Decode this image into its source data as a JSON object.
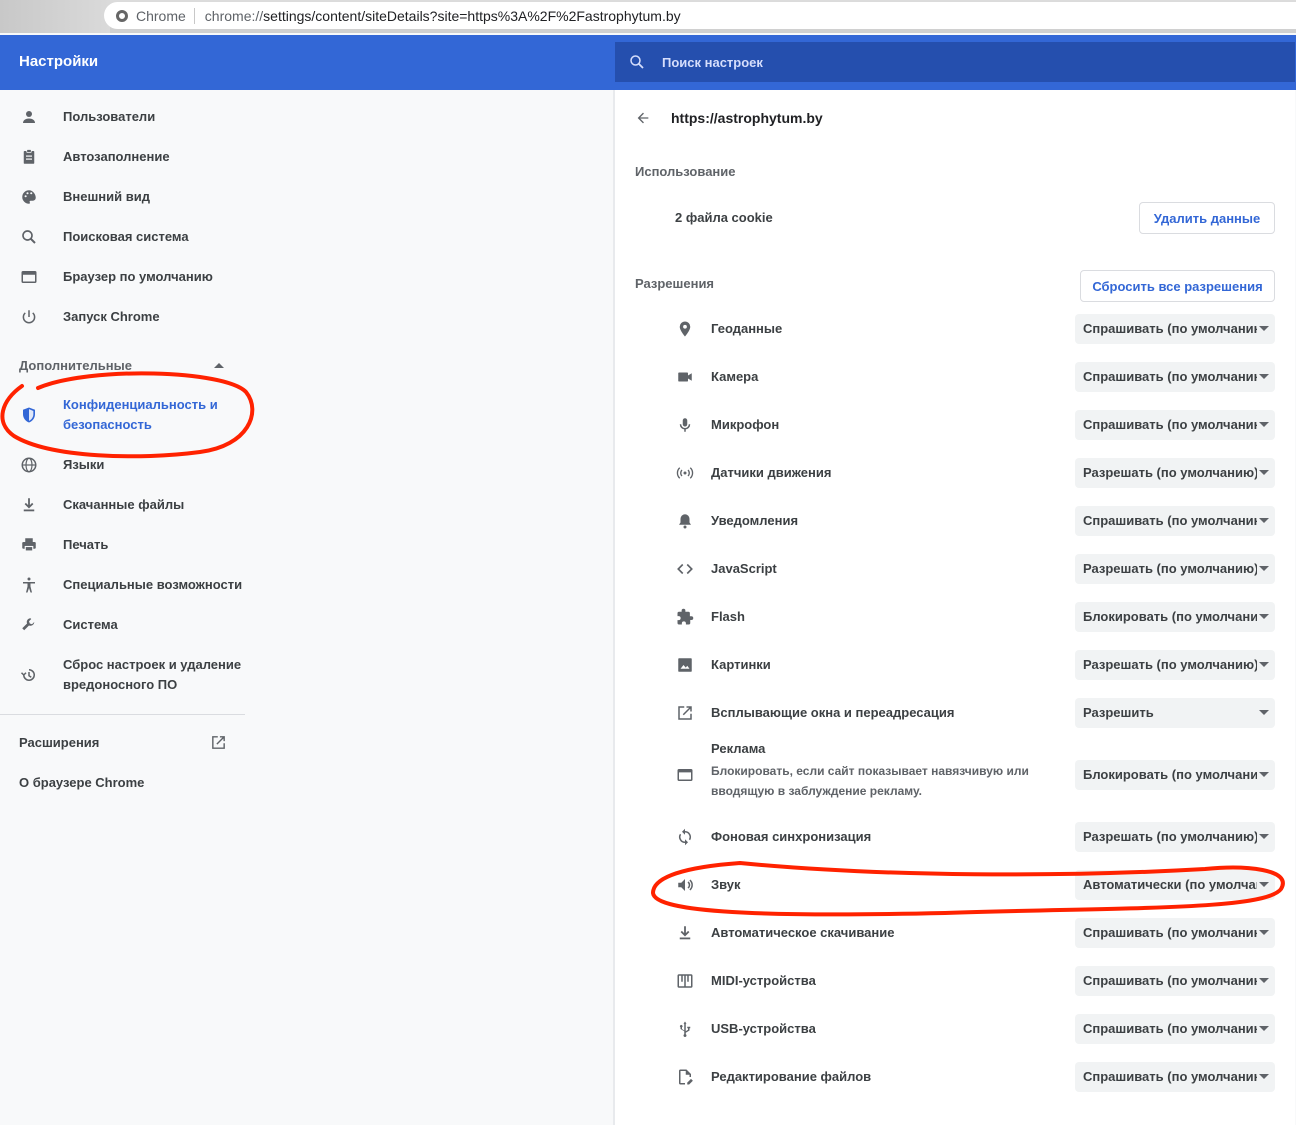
{
  "browser": {
    "site_label": "Chrome",
    "url_prefix": "chrome://",
    "url_rest": "settings/content/siteDetails?site=https%3A%2F%2Fastrophytum.by"
  },
  "header": {
    "title": "Настройки",
    "search_placeholder": "Поиск настроек"
  },
  "sidebar": {
    "items": [
      {
        "label": "Пользователи",
        "icon": "person-icon"
      },
      {
        "label": "Автозаполнение",
        "icon": "clipboard-icon"
      },
      {
        "label": "Внешний вид",
        "icon": "palette-icon"
      },
      {
        "label": "Поисковая система",
        "icon": "search-icon"
      },
      {
        "label": "Браузер по умолчанию",
        "icon": "browser-window-icon"
      },
      {
        "label": "Запуск Chrome",
        "icon": "power-icon"
      }
    ],
    "advanced_label": "Дополнительные",
    "advanced_items": [
      {
        "label": "Конфиденциальность и безопасность",
        "icon": "shield-icon"
      },
      {
        "label": "Языки",
        "icon": "globe-icon"
      },
      {
        "label": "Скачанные файлы",
        "icon": "download-icon"
      },
      {
        "label": "Печать",
        "icon": "printer-icon"
      },
      {
        "label": "Специальные возможности",
        "icon": "accessibility-icon"
      },
      {
        "label": "Система",
        "icon": "wrench-icon"
      },
      {
        "label": "Сброс настроек и удаление вредоносного ПО",
        "icon": "restore-icon"
      }
    ],
    "extensions_label": "Расширения",
    "about_label": "О браузере Chrome"
  },
  "main": {
    "site": "https://astrophytum.by",
    "usage_label": "Использование",
    "cookies": "2 файла cookie",
    "delete_button": "Удалить данные",
    "permissions_label": "Разрешения",
    "reset_button": "Сбросить все разрешения",
    "permissions": [
      {
        "name": "Геоданные",
        "value": "Спрашивать (по умолчанию)",
        "icon": "location-icon"
      },
      {
        "name": "Камера",
        "value": "Спрашивать (по умолчанию)",
        "icon": "camera-icon"
      },
      {
        "name": "Микрофон",
        "value": "Спрашивать (по умолчанию)",
        "icon": "microphone-icon"
      },
      {
        "name": "Датчики движения",
        "value": "Разрешать (по умолчанию)",
        "icon": "sensors-icon"
      },
      {
        "name": "Уведомления",
        "value": "Спрашивать (по умолчанию)",
        "icon": "bell-icon"
      },
      {
        "name": "JavaScript",
        "value": "Разрешать (по умолчанию)",
        "icon": "code-icon"
      },
      {
        "name": "Flash",
        "value": "Блокировать (по умолчанию)",
        "icon": "puzzle-icon"
      },
      {
        "name": "Картинки",
        "value": "Разрешать (по умолчанию)",
        "icon": "image-icon"
      },
      {
        "name": "Всплывающие окна и переадресация",
        "value": "Разрешить",
        "icon": "open-external-icon"
      },
      {
        "name": "Реклама",
        "desc": "Блокировать, если сайт показывает навязчивую или вводящую в заблуждение рекламу.",
        "value": "Блокировать (по умолчанию)",
        "icon": "ads-window-icon"
      },
      {
        "name": "Фоновая синхронизация",
        "value": "Разрешать (по умолчанию)",
        "icon": "sync-icon"
      },
      {
        "name": "Звук",
        "value": "Автоматически (по умолчанию)",
        "icon": "speaker-icon"
      },
      {
        "name": "Автоматическое скачивание",
        "value": "Спрашивать (по умолчанию)",
        "icon": "download-icon"
      },
      {
        "name": "MIDI-устройства",
        "value": "Спрашивать (по умолчанию)",
        "icon": "piano-icon"
      },
      {
        "name": "USB-устройства",
        "value": "Спрашивать (по умолчанию)",
        "icon": "usb-icon"
      },
      {
        "name": "Редактирование файлов",
        "value": "Спрашивать (по умолчанию)",
        "icon": "file-edit-icon"
      }
    ]
  },
  "colors": {
    "header": "#3367d6",
    "search": "#254fae",
    "annotation": "#ff2200"
  }
}
